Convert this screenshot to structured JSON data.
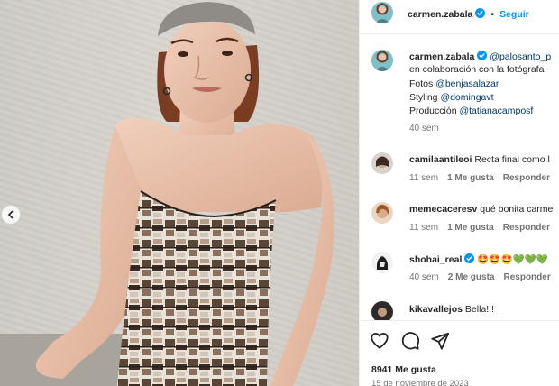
{
  "post": {
    "author": "carmen.zabala",
    "follow_label": "Seguir",
    "dot": "•"
  },
  "caption": {
    "author": "carmen.zabala",
    "mention_first": "@palosanto_p",
    "line2": "en colaboración con la fotógrafa",
    "line3_prefix": "Fotos ",
    "line3_mention": "@benjasalazar",
    "line4_prefix": "Styling ",
    "line4_mention": "@domingavt",
    "line5_prefix": "Producción ",
    "line5_mention": "@tatianacamposf",
    "time": "40 sem"
  },
  "comments": [
    {
      "user": "camilaantileoi",
      "text": "Recta final como l",
      "time": "11 sem",
      "likes": "1 Me gusta",
      "reply": "Responder"
    },
    {
      "user": "memecaceresv",
      "text": "qué bonita carme",
      "time": "11 sem",
      "likes": "1 Me gusta",
      "reply": "Responder"
    },
    {
      "user": "shohai_real",
      "text": "🤩🤩🤩💚💚💚",
      "time": "40 sem",
      "likes": "2 Me gusta",
      "reply": "Responder"
    },
    {
      "user": "kikavallejos",
      "text": "Bella!!!"
    }
  ],
  "stats": {
    "likes": "8941 Me gusta",
    "date": "15 de noviembre de 2023"
  },
  "icons": {
    "like": "heart-icon",
    "comment": "comment-icon",
    "share": "send-icon",
    "prev": "chevron-left-icon",
    "verified": "verified-badge-icon"
  },
  "colors": {
    "follow": "#0095f6",
    "link": "#00376b",
    "verified": "#0095f6",
    "meta": "#737373"
  }
}
